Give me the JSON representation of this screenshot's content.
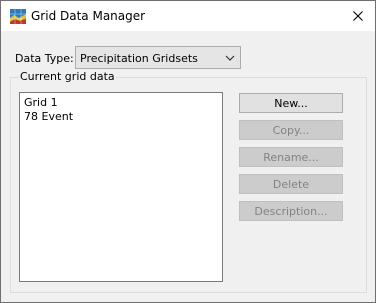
{
  "window": {
    "title": "Grid Data Manager",
    "icon": "grid-map-icon",
    "close_icon": "close-icon"
  },
  "data_type": {
    "label": "Data Type:",
    "selected": "Precipitation Gridsets"
  },
  "current_grid": {
    "label": "Current grid data",
    "items": [
      "Grid 1",
      "78 Event"
    ]
  },
  "buttons": {
    "new": "New...",
    "copy": "Copy...",
    "rename": "Rename...",
    "delete": "Delete",
    "description": "Description..."
  },
  "colors": {
    "window_bg": "#f0f0f0",
    "disabled_text": "#838383",
    "button_bg": "#e1e1e1",
    "disabled_button_bg": "#cccccc"
  }
}
